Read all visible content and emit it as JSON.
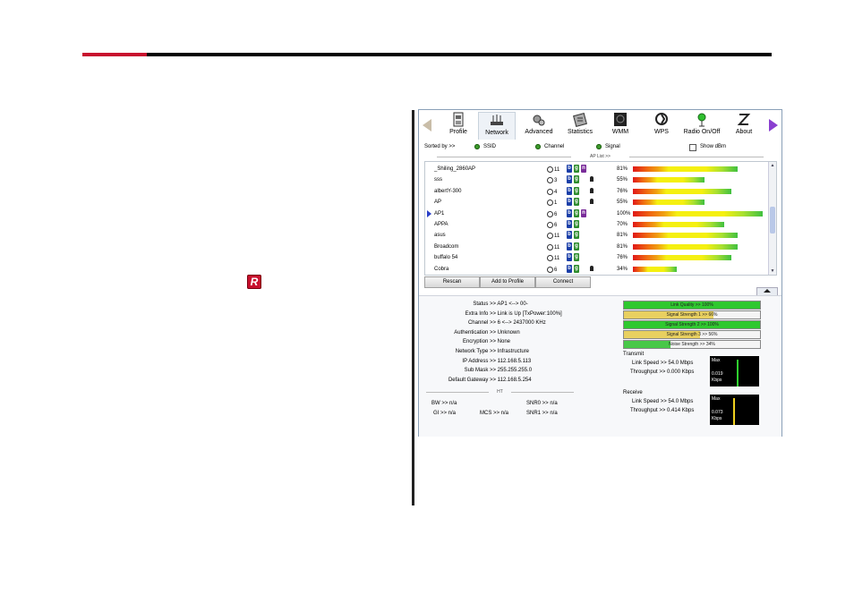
{
  "window": {
    "toolbar": [
      {
        "label": "Profile",
        "icon": "profile-icon"
      },
      {
        "label": "Network",
        "icon": "network-icon"
      },
      {
        "label": "Advanced",
        "icon": "advanced-icon"
      },
      {
        "label": "Statistics",
        "icon": "statistics-icon"
      },
      {
        "label": "WMM",
        "icon": "wmm-icon"
      },
      {
        "label": "WPS",
        "icon": "wps-icon"
      },
      {
        "label": "Radio On/Off",
        "icon": "radio-icon"
      },
      {
        "label": "About",
        "icon": "about-icon"
      }
    ],
    "sort": {
      "prefix": "Sorted by >>",
      "ssid": "SSID",
      "channel": "Channel",
      "signal": "Signal",
      "show_dbm": "Show dBm"
    },
    "ap_list_label": "AP List >>",
    "ap_list": [
      {
        "ssid": "_Shiling_2860AP",
        "channel": "11",
        "modes": [
          "b",
          "g",
          "n"
        ],
        "lock": false,
        "signal": "81%",
        "level": 0.81
      },
      {
        "ssid": "sss",
        "channel": "3",
        "modes": [
          "b",
          "g"
        ],
        "lock": true,
        "signal": "55%",
        "level": 0.55
      },
      {
        "ssid": "albertY-300",
        "channel": "4",
        "modes": [
          "b",
          "g"
        ],
        "lock": true,
        "signal": "76%",
        "level": 0.76
      },
      {
        "ssid": "AP",
        "channel": "1",
        "modes": [
          "b",
          "g"
        ],
        "lock": true,
        "signal": "55%",
        "level": 0.55
      },
      {
        "ssid": "AP1",
        "channel": "6",
        "modes": [
          "b",
          "g",
          "n"
        ],
        "lock": false,
        "signal": "100%",
        "level": 1.0,
        "selected": true
      },
      {
        "ssid": "APPA",
        "channel": "6",
        "modes": [
          "b",
          "g"
        ],
        "lock": false,
        "signal": "70%",
        "level": 0.7
      },
      {
        "ssid": "asus",
        "channel": "11",
        "modes": [
          "b",
          "g"
        ],
        "lock": false,
        "signal": "81%",
        "level": 0.81
      },
      {
        "ssid": "Broadcom",
        "channel": "11",
        "modes": [
          "b",
          "g"
        ],
        "lock": false,
        "signal": "81%",
        "level": 0.81
      },
      {
        "ssid": "buffalo 54",
        "channel": "11",
        "modes": [
          "b",
          "g"
        ],
        "lock": false,
        "signal": "76%",
        "level": 0.76
      },
      {
        "ssid": "Cobra",
        "channel": "6",
        "modes": [
          "b",
          "g"
        ],
        "lock": true,
        "signal": "34%",
        "level": 0.34
      }
    ],
    "buttons": {
      "rescan": "Rescan",
      "add_to_profile": "Add to Profile",
      "connect": "Connect"
    },
    "info": [
      {
        "k": "Status >>",
        "v": "AP1 <--> 00-"
      },
      {
        "k": "Extra Info >>",
        "v": "Link is Up [TxPower:100%]"
      },
      {
        "k": "Channel >>",
        "v": "6 <--> 2437000 KHz"
      },
      {
        "k": "Authentication >>",
        "v": "Unknown"
      },
      {
        "k": "Encryption >>",
        "v": "None"
      },
      {
        "k": "Network Type >>",
        "v": "Infrastructure"
      },
      {
        "k": "IP Address >>",
        "v": "112.168.5.113"
      },
      {
        "k": "Sub Mask >>",
        "v": "255.255.255.0"
      },
      {
        "k": "Default Gateway >>",
        "v": "112.168.5.254"
      }
    ],
    "ht_label": "HT",
    "ht": {
      "bw": "BW >> n/a",
      "gi": "GI >> n/a",
      "mcs": "MCS >> n/a",
      "snr0": "SNR0 >> n/a",
      "snr1": "SNR1 >> n/a"
    },
    "quality": [
      {
        "text": "Link Quality >> 100%",
        "level": 1.0,
        "color": "#2fc82f"
      },
      {
        "text": "Signal Strength 1 >> 66%",
        "level": 0.66,
        "color": "#e8d060"
      },
      {
        "text": "Signal Strength 2 >> 100%",
        "level": 1.0,
        "color": "#2fc82f"
      },
      {
        "text": "Signal Strength 3 >> 56%",
        "level": 0.56,
        "color": "#e8d060"
      },
      {
        "text": "Noise Strength >> 34%",
        "level": 0.34,
        "color": "#48c848"
      }
    ],
    "transmit": {
      "title": "Transmit",
      "link_speed": "Link Speed >> 54.0 Mbps",
      "throughput": "Throughput >> 0.000 Kbps",
      "graph_max": "Max",
      "graph_val": "0.019",
      "graph_unit": "Kbps",
      "line_color": "#2fd02f"
    },
    "receive": {
      "title": "Receive",
      "link_speed": "Link Speed >> 54.0 Mbps",
      "throughput": "Throughput >> 0.414 Kbps",
      "graph_max": "Max",
      "graph_val": "0.073",
      "graph_unit": "Kbps",
      "line_color": "#f0d020"
    }
  }
}
